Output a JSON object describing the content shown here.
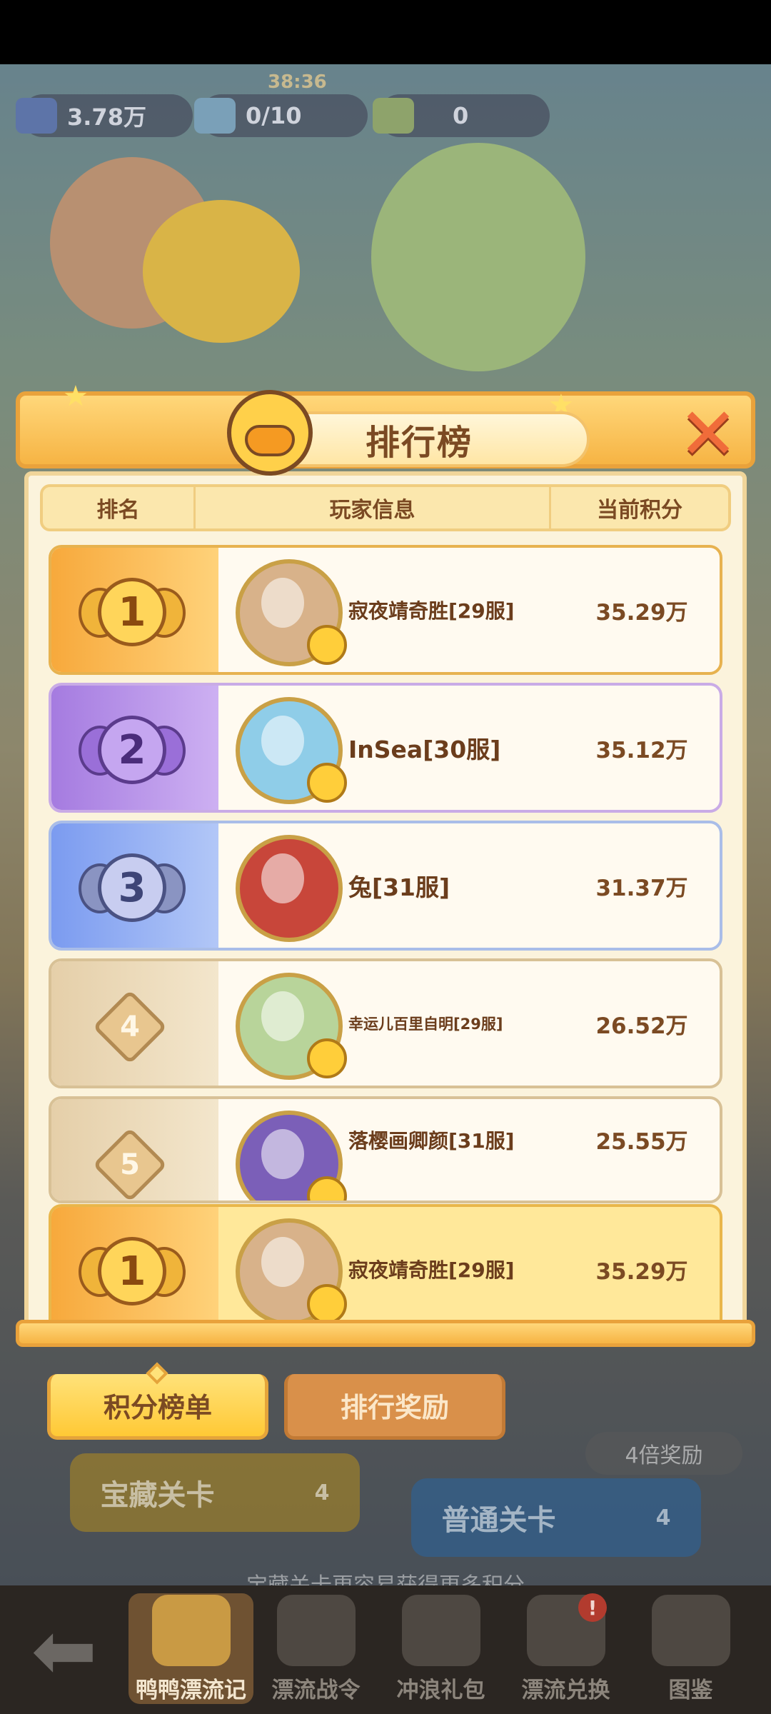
{
  "hud": {
    "resource1_value": "3.78万",
    "timer": "38:36",
    "ticket_value": "0/10",
    "resource3_value": "0"
  },
  "background": {
    "extra_button_label": "4倍奖励",
    "left_level_label": "宝藏关卡",
    "left_level_count": "4",
    "right_level_label": "普通关卡",
    "right_level_count": "4",
    "hint_text": "宝藏关卡更容易获得更多积分"
  },
  "popup": {
    "title": "排行榜",
    "columns": {
      "rank": "排名",
      "player": "玩家信息",
      "score": "当前积分"
    },
    "rows": [
      {
        "rank": "1",
        "name": "寂夜靖奇胜[29服]",
        "score": "35.29万"
      },
      {
        "rank": "2",
        "name": "InSea[30服]",
        "score": "35.12万"
      },
      {
        "rank": "3",
        "name": "兔[31服]",
        "score": "31.37万"
      },
      {
        "rank": "4",
        "name": "幸运儿百里自明[29服]",
        "score": "26.52万"
      },
      {
        "rank": "5",
        "name": "落樱画卿颜[31服]",
        "score": "25.55万"
      }
    ],
    "my_row": {
      "rank": "1",
      "name": "寂夜靖奇胜[29服]",
      "score": "35.29万"
    }
  },
  "tabs": {
    "active": "积分榜单",
    "inactive": "排行奖励"
  },
  "bottom_nav": {
    "items": [
      "鸭鸭漂流记",
      "漂流战令",
      "冲浪礼包",
      "漂流兑换",
      "图鉴"
    ],
    "badge": "!"
  },
  "colors": {
    "popup_orange": "#f6b444",
    "body_cream": "#fbf3dc",
    "text_brown": "#7b4a23",
    "nav_dark": "#2b2622"
  },
  "icons": [
    "close-icon",
    "duck-icon",
    "back-arrow-icon",
    "medal-icon",
    "star-icon"
  ]
}
